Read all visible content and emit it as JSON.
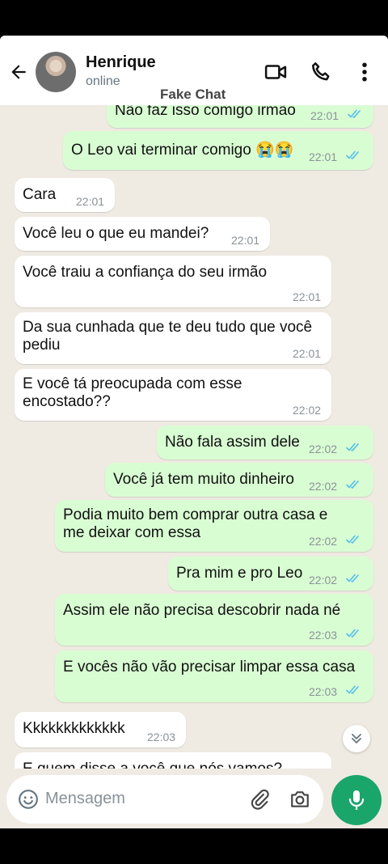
{
  "header": {
    "name": "Henrique",
    "status": "online",
    "watermark": "Fake Chat"
  },
  "messages": [
    {
      "dir": "out",
      "text": "Não faz isso comigo irmão",
      "time": "22:01",
      "ticks": "read"
    },
    {
      "dir": "out",
      "text": "O Leo vai terminar comigo 😭😭",
      "time": "22:01",
      "ticks": "read"
    },
    {
      "dir": "in",
      "text": "Cara",
      "time": "22:01"
    },
    {
      "dir": "in",
      "text": "Você leu o que eu mandei?",
      "time": "22:01"
    },
    {
      "dir": "in",
      "text": "Você traiu a confiança do seu irmão",
      "time": "22:01"
    },
    {
      "dir": "in",
      "text": "Da sua cunhada que te deu tudo que você\npediu",
      "time": "22:01"
    },
    {
      "dir": "in",
      "text": "E você tá preocupada com esse\nencostado??",
      "time": "22:02"
    },
    {
      "dir": "out",
      "text": "Não fala assim dele",
      "time": "22:02",
      "ticks": "read"
    },
    {
      "dir": "out",
      "text": "Você já tem muito dinheiro",
      "time": "22:02",
      "ticks": "read"
    },
    {
      "dir": "out",
      "text": "Podia muito bem comprar outra casa e\nme deixar com essa",
      "time": "22:02",
      "ticks": "read"
    },
    {
      "dir": "out",
      "text": "Pra mim e pro Leo",
      "time": "22:02",
      "ticks": "read"
    },
    {
      "dir": "out",
      "text": "Assim ele não precisa descobrir nada né",
      "time": "22:03",
      "ticks": "read"
    },
    {
      "dir": "out",
      "text": "E vocês não vão precisar limpar essa casa",
      "time": "22:03",
      "ticks": "read"
    },
    {
      "dir": "in",
      "text": "Kkkkkkkkkkkkk",
      "time": "22:03"
    },
    {
      "dir": "in",
      "text": "E quem disse a você que nós vamos?",
      "time": ""
    }
  ],
  "composer": {
    "placeholder": "Mensagem"
  },
  "icons": {
    "back": "arrow-back-icon",
    "video": "video-call-icon",
    "phone": "phone-call-icon",
    "menu": "more-vert-icon",
    "emoji": "emoji-icon",
    "attach": "paperclip-icon",
    "camera": "camera-icon",
    "mic": "microphone-icon",
    "scroll": "chevrons-down-icon"
  },
  "colors": {
    "outgoing_bubble": "#d9fdd3",
    "incoming_bubble": "#ffffff",
    "read_ticks": "#53bdeb",
    "accent": "#1aa56b",
    "chat_background": "#efeae2"
  }
}
